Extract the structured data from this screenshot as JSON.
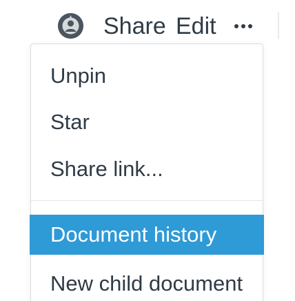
{
  "toolbar": {
    "avatar_icon": "user-avatar-icon",
    "share_label": "Share",
    "edit_label": "Edit",
    "more_icon": "more-horizontal-icon"
  },
  "menu": {
    "items": [
      {
        "label": "Unpin"
      },
      {
        "label": "Star"
      },
      {
        "label": "Share link..."
      },
      {
        "label": "Document history",
        "highlighted": true
      },
      {
        "label": "New child document"
      }
    ],
    "highlight_color": "#2e9ad6"
  },
  "colors": {
    "text": "#2f3b46",
    "highlight_text": "#ffffff",
    "background": "#ffffff"
  }
}
